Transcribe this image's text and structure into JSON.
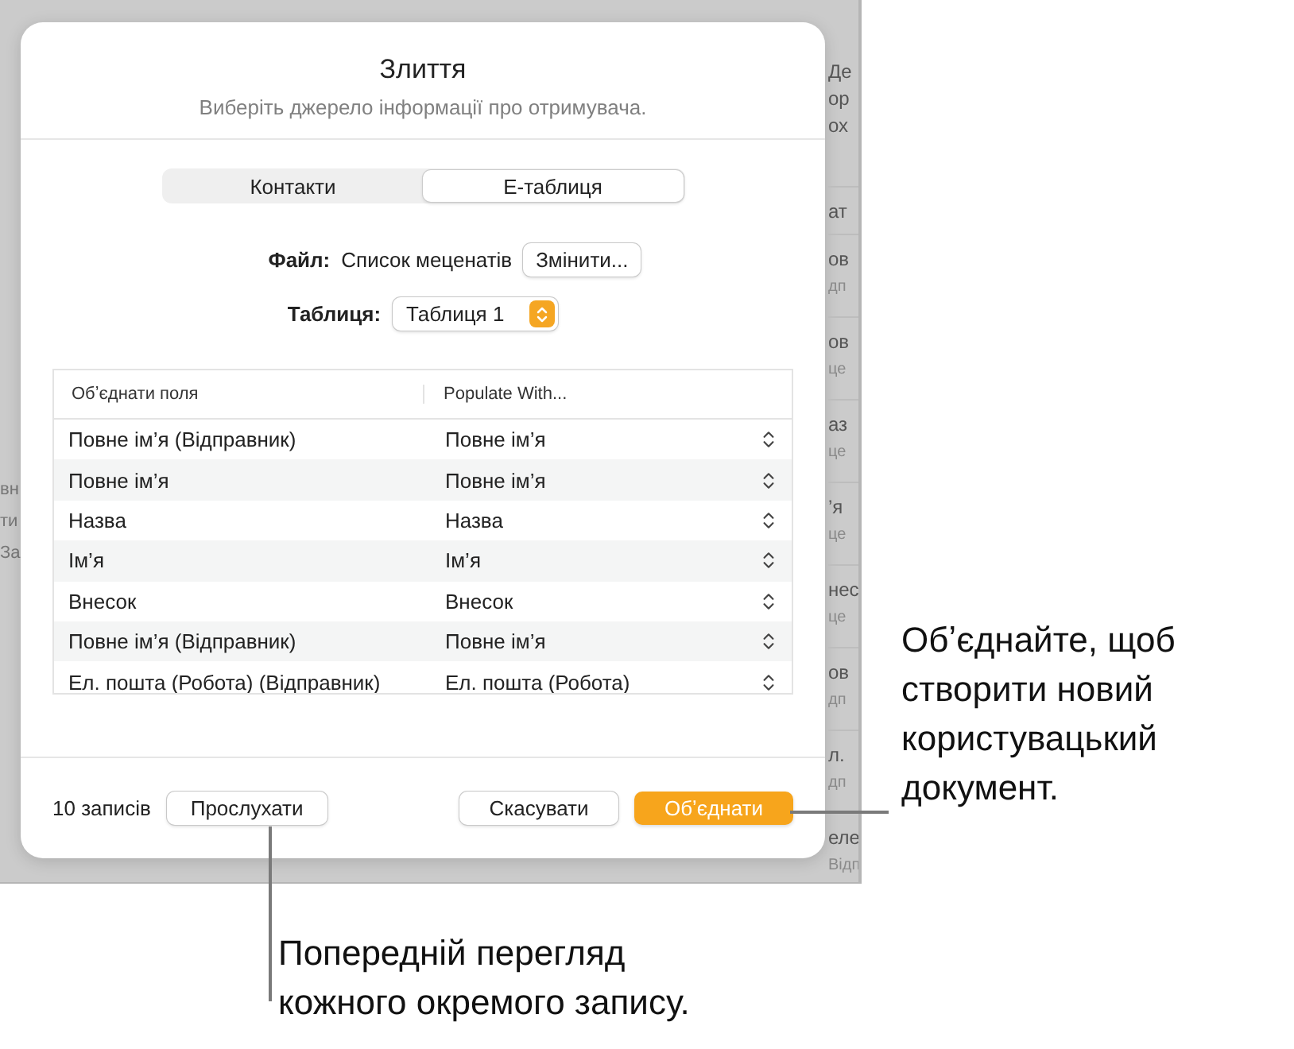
{
  "backdrop": {
    "left_fragments": [
      "вн",
      "ти",
      "За"
    ],
    "right_items": [
      {
        "lines": [
          "Де",
          "ор",
          "ох"
        ]
      },
      {
        "lines": [
          "ат"
        ]
      },
      {
        "lines": [
          "ов",
          "дп"
        ]
      },
      {
        "lines": [
          "ов",
          "це"
        ]
      },
      {
        "lines": [
          "аз",
          "це"
        ]
      },
      {
        "lines": [
          "’я",
          "це"
        ]
      },
      {
        "lines": [
          "нес",
          "це"
        ]
      },
      {
        "lines": [
          "ов",
          "дп"
        ]
      },
      {
        "lines": [
          "л.",
          "дп"
        ]
      },
      {
        "lines": [
          "еле",
          "Відп"
        ]
      }
    ]
  },
  "dialog": {
    "title": "Злиття",
    "subtitle": "Виберіть джерело інформації про отримувача.",
    "tabs": [
      {
        "label": "Контакти",
        "selected": false
      },
      {
        "label": "Е-таблиця",
        "selected": true
      }
    ],
    "file": {
      "label": "Файл:",
      "value": "Список меценатів",
      "button": "Змінити..."
    },
    "table_select": {
      "label": "Таблиця:",
      "value": "Таблиця 1"
    },
    "mapping": {
      "columns": [
        "Обʼєднати поля",
        "Populate With..."
      ],
      "rows": [
        {
          "field": "Повне ім’я (Відправник)",
          "value": "Повне ім’я"
        },
        {
          "field": "Повне ім’я",
          "value": "Повне ім’я"
        },
        {
          "field": "Назва",
          "value": "Назва"
        },
        {
          "field": "Ім’я",
          "value": "Ім’я"
        },
        {
          "field": "Внесок",
          "value": "Внесок"
        },
        {
          "field": "Повне ім’я (Відправник)",
          "value": "Повне ім’я"
        },
        {
          "field": "Ел. пошта (Робота) (Відправник)",
          "value": "Ел. пошта (Робота)"
        }
      ]
    },
    "footer": {
      "count": "10 записів",
      "buttons": [
        {
          "label": "Прослухати",
          "kind": "default"
        },
        {
          "label": "Скасувати",
          "kind": "default"
        },
        {
          "label": "Обʼєднати",
          "kind": "primary"
        }
      ]
    }
  },
  "callouts": [
    {
      "text": "Обʼєднайте, щоб\nстворити новий\nкористувацький\nдокумент."
    },
    {
      "text": "Попередній перегляд\nкожного окремого запису."
    }
  ]
}
